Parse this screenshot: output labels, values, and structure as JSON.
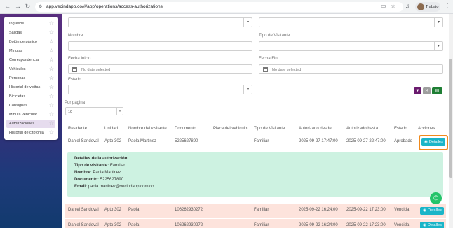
{
  "browser": {
    "url": "app.vecindapp.co/#/app/operations/access-authorizations",
    "profile_label": "Trabajo",
    "icons": [
      "back-icon",
      "forward-icon",
      "reload-icon",
      "site-info-icon",
      "cast-icon",
      "bookmark-star-icon",
      "media-icon",
      "menu-kebab-icon"
    ]
  },
  "menu": {
    "items": [
      {
        "label": "Ingresos"
      },
      {
        "label": "Salidas"
      },
      {
        "label": "Botón de pánico"
      },
      {
        "label": "Minutas"
      },
      {
        "label": "Correspondencia"
      },
      {
        "label": "Vehiculos"
      },
      {
        "label": "Personas"
      },
      {
        "label": "Historial de visitas"
      },
      {
        "label": "Bicicletas"
      },
      {
        "label": "Consignas"
      },
      {
        "label": "Minuta vehicular"
      },
      {
        "label": "Autorizaciones",
        "active": true
      },
      {
        "label": "Historial de citofonía"
      }
    ]
  },
  "filters": {
    "nombre_label": "Nombre",
    "tipo_visitante_label": "Tipo de Visitante",
    "fecha_inicio_label": "Fecha Inicio",
    "fecha_fin_label": "Fecha Fin",
    "date_placeholder": "No date selected",
    "estado_label": "Estado",
    "por_pagina_label": "Por página",
    "por_pagina_value": "10"
  },
  "table": {
    "headers": [
      "Residente",
      "Unidad",
      "Nombre del visitante",
      "Documento",
      "Placa del vehiculo",
      "Tipo de Visitante",
      "Autorizado desde",
      "Autorizado hasta",
      "Estado",
      "Acciones"
    ],
    "rows": [
      {
        "residente": "Daniel Sandoval",
        "unidad": "Apto 302",
        "visitante": "Paola Martinez",
        "documento": "5225627890",
        "placa": "",
        "tipo": "Familiar",
        "desde": "2025-09-27 17:47:00",
        "hasta": "2025-09-27 22:47:00",
        "estado": "Aprobado",
        "accion": "Detalles"
      },
      {
        "residente": "Daniel Sandoval",
        "unidad": "Apto 302",
        "visitante": "Paola",
        "documento": "106262930272",
        "placa": "",
        "tipo": "Familiar",
        "desde": "2025-09-22 16:24:00",
        "hasta": "2025-09-22 17:23:00",
        "estado": "Vencida",
        "accion": "Detalles"
      },
      {
        "residente": "Daniel Sandoval",
        "unidad": "Apto 302",
        "visitante": "Paola",
        "documento": "106262930272",
        "placa": "",
        "tipo": "Familiar",
        "desde": "2025-09-22 16:24:00",
        "hasta": "2025-09-22 17:23:00",
        "estado": "Vencida",
        "accion": "Detalles"
      }
    ]
  },
  "details": {
    "title": "Detalles de la autorización:",
    "tipo_label": "Tipo de visitante:",
    "tipo_value": "Familiar",
    "nombre_label": "Nombre:",
    "nombre_value": "Paola Martinez",
    "documento_label": "Documento:",
    "documento_value": "5225627890",
    "email_label": "Email:",
    "email_value": "paola.martinez@vecindapp.com.co"
  },
  "colors": {
    "accent": "#1ab5c8",
    "highlight": "#f08a1c",
    "panel": "#cdf2e1",
    "expired_row": "#fde3dc",
    "filter_btn": "#6a1b6e",
    "clear_btn": "#9e9e9e",
    "excel_btn": "#1e7e34"
  }
}
